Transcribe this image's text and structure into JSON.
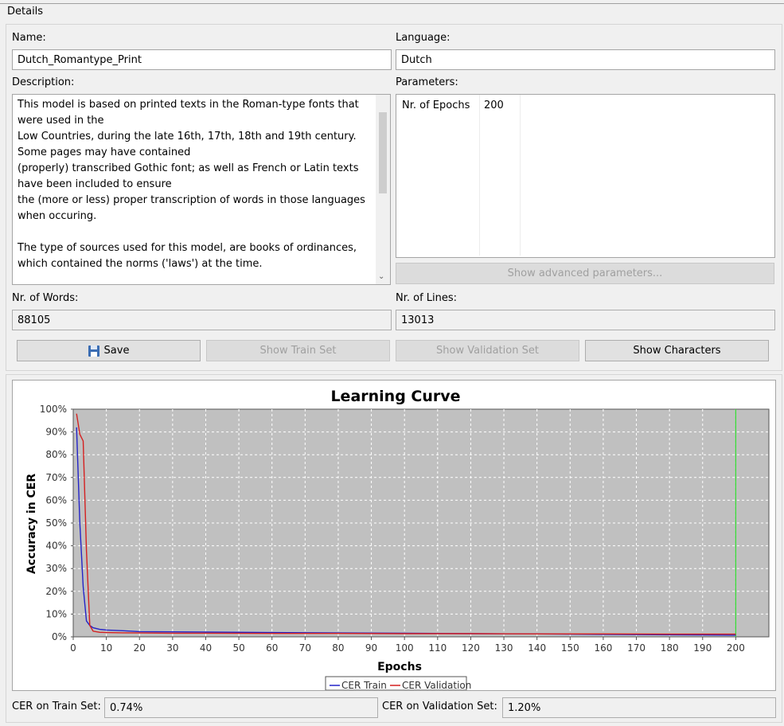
{
  "group": {
    "title": "Details"
  },
  "form": {
    "name_label": "Name:",
    "name_value": "Dutch_Romantype_Print",
    "language_label": "Language:",
    "language_value": "Dutch",
    "description_label": "Description:",
    "description_value": "This model is based on printed texts in the Roman-type fonts that were used in the\nLow Countries, during the late 16th, 17th, 18th and 19th century.\nSome pages may have contained\n(properly) transcribed Gothic font; as well as French or Latin texts have been included to ensure\nthe (more or less) proper transcription of words in those languages when occuring.\n\nThe type of sources used for this model, are books of ordinances, which contained the norms ('laws') at the time.",
    "parameters_label": "Parameters:",
    "parameters": [
      {
        "key": "Nr. of Epochs",
        "value": "200"
      }
    ],
    "show_advanced": "Show advanced parameters...",
    "words_label": "Nr. of Words:",
    "words_value": "88105",
    "lines_label": "Nr. of Lines:",
    "lines_value": "13013"
  },
  "buttons": {
    "save": "Save",
    "show_train": "Show Train Set",
    "show_validation": "Show Validation Set",
    "show_characters": "Show Characters"
  },
  "chart_data": {
    "type": "line",
    "title": "Learning Curve",
    "xlabel": "Epochs",
    "ylabel": "Accuracy in CER",
    "xlim": [
      0,
      210
    ],
    "ylim": [
      0,
      100
    ],
    "xticks": [
      0,
      10,
      20,
      30,
      40,
      50,
      60,
      70,
      80,
      90,
      100,
      110,
      120,
      130,
      140,
      150,
      160,
      170,
      180,
      190,
      200
    ],
    "yticks": [
      "0%",
      "10%",
      "20%",
      "30%",
      "40%",
      "50%",
      "60%",
      "70%",
      "80%",
      "90%",
      "100%"
    ],
    "grid": true,
    "marker_x": 200,
    "legend_placement": "bottom",
    "series": [
      {
        "name": "CER Train",
        "color": "#2323c8",
        "x": [
          1,
          2,
          3,
          4,
          5,
          6,
          8,
          10,
          15,
          20,
          30,
          40,
          60,
          80,
          100,
          120,
          140,
          160,
          180,
          200
        ],
        "y": [
          92,
          50,
          22,
          7,
          5,
          4,
          3.3,
          3,
          2.7,
          2.3,
          2.2,
          2.1,
          1.9,
          1.7,
          1.6,
          1.4,
          1.3,
          1.1,
          0.9,
          0.74
        ]
      },
      {
        "name": "CER Validation",
        "color": "#d42020",
        "x": [
          1,
          2,
          3,
          4,
          5,
          6,
          8,
          10,
          15,
          20,
          30,
          40,
          60,
          80,
          100,
          120,
          140,
          160,
          180,
          200
        ],
        "y": [
          98,
          89,
          86,
          38,
          5,
          2.5,
          2,
          1.9,
          1.8,
          1.7,
          1.6,
          1.6,
          1.5,
          1.5,
          1.4,
          1.4,
          1.3,
          1.3,
          1.2,
          1.2
        ]
      }
    ]
  },
  "stats": {
    "cer_train_label": "CER on Train Set:",
    "cer_train_value": "0.74%",
    "cer_val_label": "CER on Validation Set:",
    "cer_val_value": "1.20%"
  }
}
